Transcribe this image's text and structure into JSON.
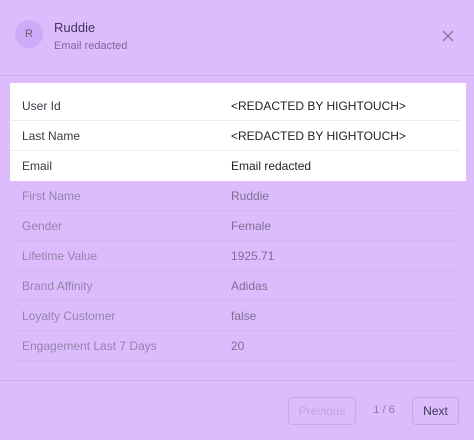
{
  "header": {
    "avatar_initial": "R",
    "name": "Ruddie",
    "email": "Email redacted"
  },
  "highlighted_rows": [
    {
      "label": "User Id",
      "value": "<REDACTED BY HIGHTOUCH>"
    },
    {
      "label": "Last Name",
      "value": "<REDACTED BY HIGHTOUCH>"
    },
    {
      "label": "Email",
      "value": "Email redacted"
    }
  ],
  "rows": [
    {
      "label": "First Name",
      "value": "Ruddie"
    },
    {
      "label": "Gender",
      "value": "Female"
    },
    {
      "label": "Lifetime Value",
      "value": "1925.71"
    },
    {
      "label": "Brand Affinity",
      "value": "Adidas"
    },
    {
      "label": "Loyalty Customer",
      "value": "false"
    },
    {
      "label": "Engagement Last 7 Days",
      "value": "20"
    }
  ],
  "footer": {
    "previous_label": "Previous",
    "page_indicator": "1 / 6",
    "next_label": "Next"
  },
  "icons": {
    "close": "close-icon"
  }
}
